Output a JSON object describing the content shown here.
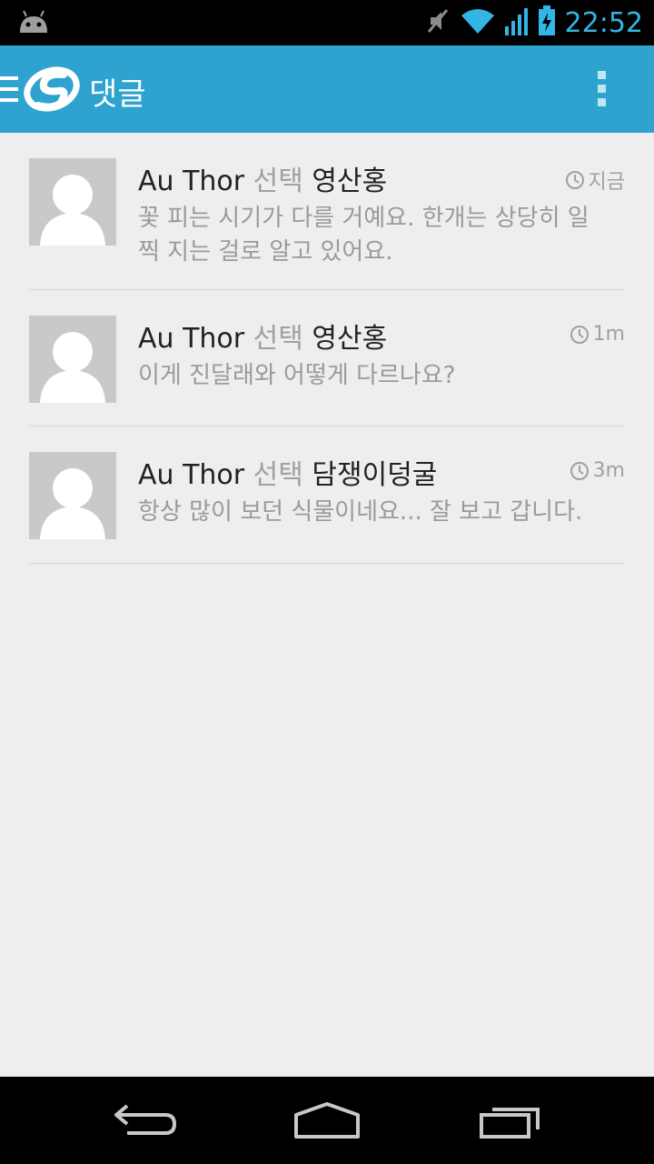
{
  "status_bar": {
    "time": "22:52",
    "icons": [
      "android-icon",
      "mute-icon",
      "wifi-icon",
      "signal-icon",
      "battery-charging-icon"
    ]
  },
  "action_bar": {
    "title": "댓글",
    "icons": [
      "drawer-icon",
      "app-logo-icon",
      "overflow-menu-icon"
    ],
    "color": "#2ea3d0"
  },
  "comments": [
    {
      "author": "Au Thor",
      "verb": "선택",
      "target": "영산홍",
      "time": "지금",
      "text": "꽃 피는 시기가 다를 거예요. 한개는 상당히 일찍 지는 걸로 알고 있어요."
    },
    {
      "author": "Au Thor",
      "verb": "선택",
      "target": "영산홍",
      "time": "1m",
      "text": "이게 진달래와 어떻게 다르나요?"
    },
    {
      "author": "Au Thor",
      "verb": "선택",
      "target": "담쟁이덩굴",
      "time": "3m",
      "text": "항상 많이 보던 식물이네요... 잘 보고 갑니다."
    }
  ],
  "nav_bar": {
    "icons": [
      "back-icon",
      "home-icon",
      "recent-apps-icon"
    ]
  }
}
